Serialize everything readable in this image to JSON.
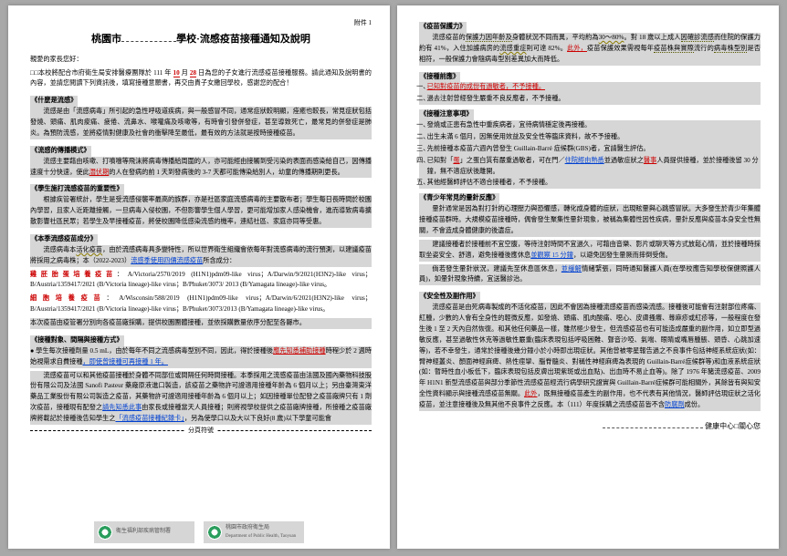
{
  "doc": {
    "attachment_label": "附件 1",
    "title_prefix": "桃園市",
    "title_suffix": "學校·流感疫苗接種通知及說明",
    "greeting": "親愛的家長您好：",
    "intro_p1_a": "□□本校將配合市府衛生局安排醫療團隊於 111 年",
    "intro_month": "10",
    "intro_day": "28",
    "intro_p1_b": "日為您的子女進行流感疫苗接種服務。請此通知及說明書的內容，並請您閱讀下列資訊後，填寫接種意願書，再交由貴子女繳回學校，感謝您的配合！",
    "sec1_title": "《什麼是流感》",
    "sec1_body": "流感是由「流感病毒」所引起的急性呼吸道疾病，與一般感冒不同，通常症狀較明顯，痊癒也較長，常見症狀包括發燒、頭痛、肌肉痠痛、疲倦、流鼻水、喉嚨痛及咳嗽等，有時會引發併發症，甚至導致死亡，最常見的併發症是肺炎。為預防流感，並將疫情對健康及社會的衝擊降至最低，最有效的方法就是按時接種疫苗。",
    "sec2_title": "《流感的傳播模式》",
    "sec2_body_a": "流感主要藉由咳嗽、打噴嚏等飛沫將病毒傳播給周圍的人，亦可能經由接觸到受污染的表面而感染給自己，因傳播速度十分快速，使此",
    "sec2_underline": "潛伏期",
    "sec2_body_b": "的人在發病的前 1 天到發病後的 3-7 天都可能傳染給別人，幼童的傳播期則更長。",
    "sec3_title": "《學生施打流感疫苗的重要性》",
    "sec3_body": "根據疾管署統計，學生是受流感侵襲率最高的族群，亦是社區家庭流感病毒的主要散布者；學生每日長時間於校園內學習，且家人近距離接觸，一旦病毒入侵校園，不但影響學生個人學習，更可能增加家人感染機會，進而導致病毒擴散影響社區民眾；若學生及早接種疫苗，將使校園降低感染流感的機率，連結社區、家庭亦同等受惠。",
    "sec4_title": "《本季流感疫苗成分》",
    "sec4_body_a": "流感病毒本",
    "sec4_wavy": "活化疫苗",
    "sec4_body_b": "，由於流感病毒具多變特性，所以世界衛生組織會依每年對流感病毒的流行預測，以建議疫苗將採用之病毒株；本（2022-2023）",
    "sec4_blue": "流感季使用四價流感疫苗",
    "sec4_body_c": "所含成分：",
    "vaccine1_label": "雞胚胎蛋培養疫苗",
    "vaccine1_text": "：A/Victoria/2570/2019 (H1N1)pdm09-like virus；A/Darwin/9/2021(H3N2)-like virus；B/Austria/1359417/2021 (B/Victoria lineage)-like virus；B/Phuket/3073/ 2013 (B/Yamagata lineage)-like virus。",
    "vaccine2_label": "細胞培養疫苗",
    "vaccine2_text": "：A/Wisconsin/588/2019 (H1N1)pdm09-like virus；A/Darwin/6/2021(H3N2)-like virus；B/Austria/1359417/2021 (B/Victoria lineage)-like virus；B/Phuket/3073/2013 (B/Yamagata lineage)-like virus。",
    "sec4_note": "本次疫苗由疫管署分別向各疫苗廠採購，提供校園團體接種，並依採購數量依序分配至各縣市。",
    "sec5_title": "《接種對象、間隔與接種方式》",
    "sec5_bullet_a": "學生每次接種劑量 0.5 mL，由於每年不同之流感病毒型別不同，因此，得於接種後",
    "sec5_underline1": "應先知悉補助接種",
    "sec5_bullet_b": "時程少於 2 週時始視需求自費接種",
    "sec5_underline2": "，即使曾接種可再接種 1 年。",
    "sec5_p2": "流感疫苗可以和其他疫苗接種於身體不同部位或間隔任何時間接種。本季採用之流感疫苗由法國及國內藥物科技股份有限公司及法國 Sanofi Pasteur 藥廠原液進口製造，該疫苗之藥物許可證適用接種年齡為 6 個月以上；另由臺灣東洋藥品工業股份有限公司製造之疫苗，其藥物許可證適用接種年齡為 6 個月以上；如因接種單位配發之疫苗廠牌只有 1 劑次疫苗，接種現有配發之",
    "sec5_red1": "請先知悉此事",
    "sec5_p2b": "由家長或接種當天人員接種；則將視學校提供之疫苗廠牌接種，所接種之疫苗廠牌將載記於接種後告知學生之",
    "sec5_red2": "「流感疫苗接種紀錄卡」",
    "sec5_p2c": "，另為使學口以及大以下良好(8 歲)以下學童可能會",
    "p2_sec1_title": "《疫苗保護力》",
    "p2_sec1_body_a": "流感疫苗的",
    "p2_sec1_dot": "保護力因年齡及",
    "p2_sec1_body_b": "身體狀況不同而異，平均約為",
    "p2_sec1_wavy1": "30～80%",
    "p2_sec1_body_c": "。對 18 歲以上成人",
    "p2_sec1_dot2": "因確診流感",
    "p2_sec1_body_d": "而住院的保護力約有 41%，入住加護病房的",
    "p2_sec1_wavy2": "流感重症",
    "p2_sec1_body_e": "則可達 82%。",
    "p2_sec1_red": "此外，",
    "p2_sec1_body_f": "疫苗保護效果需視每年",
    "p2_sec1_dot3": "疫苗株與實際",
    "p2_sec1_body_g": "流行的",
    "p2_sec1_dot4": "病毒株型別",
    "p2_sec1_body_h": "是否相符，一般保護力會隨病毒型別差異加大而降低。",
    "p2_sec2_title": "《接種前應》",
    "p2_sec2_li1": "已知對疫苗的成份有過敏者，不予接種。",
    "p2_sec2_li2": "過去注射曾經發生嚴重不良反應者，不予接種。",
    "p2_sec3_title": "《接種注意事項》",
    "p2_sec3_li1": "發燒或正患有急性中重疾病者，宜待病情穩定後再接種。",
    "p2_sec3_li2": "出生未滿 6 個月，因無使用效益及安全性等臨床資料，故不予接種。",
    "p2_sec3_li3": "先前接種本疫苗六週內曾發生 Guillain-Barré 症候群(GBS)者，宜請醫生評估。",
    "p2_sec3_li4_a": "已知對「",
    "p2_sec3_li4_red": "蛋",
    "p2_sec3_li4_b": "」之蛋白質有嚴重過敏者，可在門／",
    "p2_sec3_li4_blue": "住院經由熟悉",
    "p2_sec3_li4_c": "並過敏症狀之",
    "p2_sec3_li4_red2": "醫事",
    "p2_sec3_li4_d": "人員提供接種，並於接種後留 30 分鐘，無不適症狀後離開。",
    "p2_sec3_li5": "其他經醫師評估不適合接種者，不予接種。",
    "p2_sec4_title": "《青少年常見的暈針反應》",
    "p2_sec4_body_a": "暈針通常是因為對打針的心理壓力與恐懼感，轉化成身體的症狀，出現眩暈與心跳感冒狀。大多發生於青少年集體接種疫苗群時。大規模疫苗接種時，偶會發生聚集性暈針現象，被稱為集體性因性疾病，暈針反應與疫苗本身安全性無關，不會造成身體健康的後遺症。",
    "p2_sec4_body_b": "建議接種者於接種前不宜空腹，等待注射時間不宜過久，可藉由音樂、影片或聊天等方式放鬆心情，並於接種時採取坐姿安全、舒適，避免接種後應休息",
    "p2_sec4_blue": "並觀察 15 分鐘",
    "p2_sec4_body_c": "，以避免因發生暈厥而摔倒受傷。",
    "p2_sec4_body_d": "倘若發生暈針狀況，建議先至休息區休息，",
    "p2_sec4_blue2": "並緩解",
    "p2_sec4_body_e": "情緒緊張，同時通知醫護人員(在學校應告知學校保健照護人員)，如暈針現象持續，宜送醫診治。",
    "p2_sec5_title": "《安全性及副作用》",
    "p2_sec5_body": "流感疫苗是由死病毒製成的不活化疫苗，因此不會因為接種流感疫苗而感染流感。接種後可能會有注射部位疼痛、紅腫，少數的人會有全身性的輕微反應，如發燒、頭痛、肌肉酸痛、噁心、皮膚搔癢、蕁麻疹或紅疹等，一般程度在發生後 1 至 2 天內自然恢復。和其他任何藥品一樣，雖然極少發生，但流感疫苗也有可能造成嚴重的副作用，如立即型過敏反應，甚至過敏性休克等過敏性嚴重(臨床表現包括呼吸困難、聲音沙啞、氣喘、眼睛或嘴唇腫脹、頭昏、心跳加速等)，若不幸發生，通常於接種後幾分鐘小於小時即出現症狀。其他曾被零星報告過之不良事件包括神經系統症狀(如：臂神經叢炎、顏面神經麻痺、熱性痙攣、腦脊髓炎、對稱性神經麻痺為表現的 Guillain-Barré症候群等)和血液系統症狀(如：暫時性血小板低下，臨床表現包括皮膚出現紫斑或出血點)、出血時不易止血等)。除了 1976 年豬流感疫苗、2009 年 H1N1 新型流感疫苗與部分季節性流感疫苗經流行病學研究證實與 Guillain-Barré症候群可能相關外，其餘皆有與知安全性資料顯示與接種流感疫苗無關。",
    "p2_sec5_red": "此外",
    "p2_sec5_body2": "，既無接種疫苗產生的副作用，也不代表有其他情況，醫師評估現症狀之活化疫苗，並注意接種後及無其他不良事件之反應。本（111）年度採購之流感疫苗皆不含",
    "p2_sec5_blue": "防腐劑",
    "p2_sec5_body3": "成份。",
    "footer_right": "健康中心□關心您",
    "cutline": "分頁符號",
    "stamp1_top": "衛生福利部疾病管制署",
    "stamp1_sub": "",
    "stamp2_top": "桃園市政府衛生局",
    "stamp2_sub": "Department of Public Health, Taoyuan"
  }
}
